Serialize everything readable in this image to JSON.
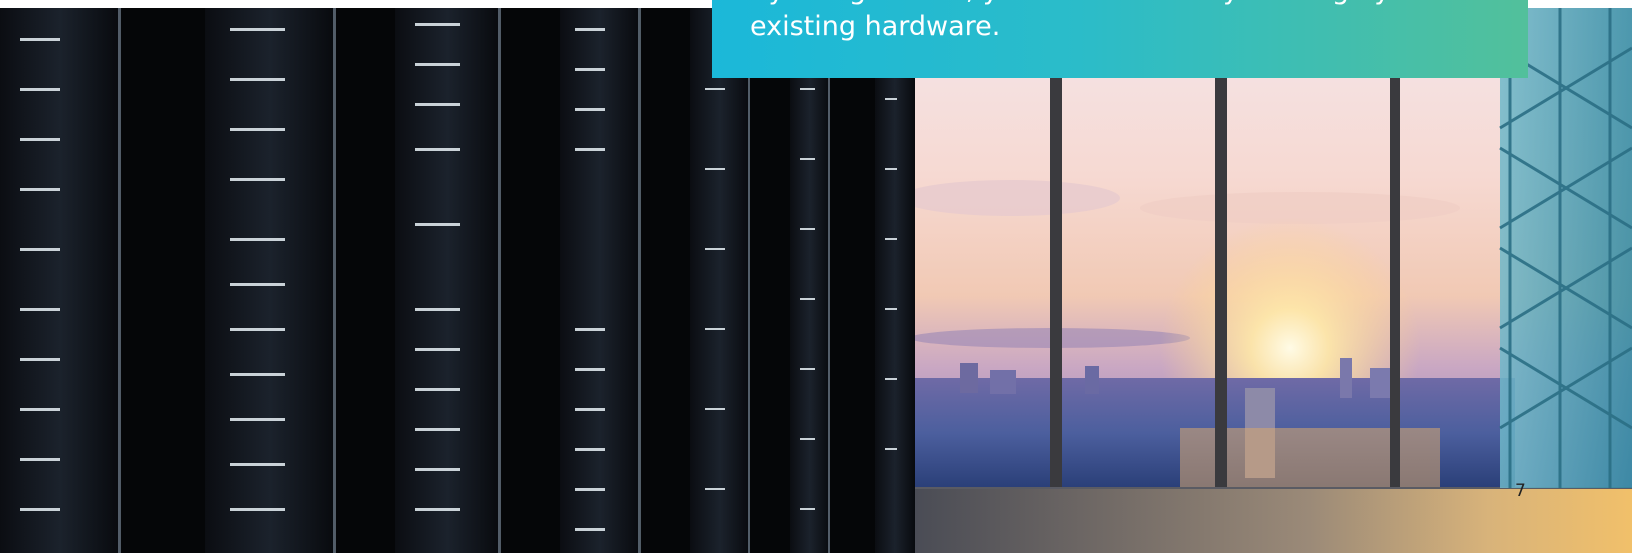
{
  "callout": {
    "line_partial": "By using KEEBO, you can effectively leverage your",
    "line_full": "existing hardware."
  },
  "page": {
    "number": "7"
  },
  "colors": {
    "callout_start": "#1bb8d9",
    "callout_end": "#52c09b"
  }
}
